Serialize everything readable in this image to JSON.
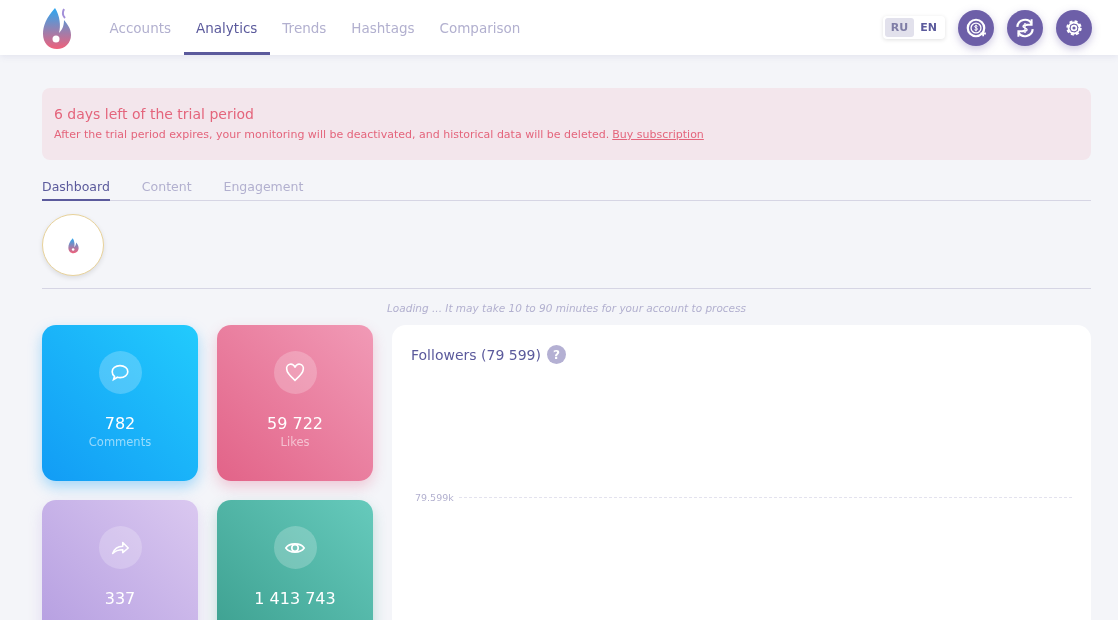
{
  "nav": {
    "items": [
      {
        "label": "Accounts",
        "selected": false
      },
      {
        "label": "Analytics",
        "selected": true
      },
      {
        "label": "Trends",
        "selected": false
      },
      {
        "label": "Hashtags",
        "selected": false
      },
      {
        "label": "Comparison",
        "selected": false
      }
    ]
  },
  "languages": [
    {
      "label": "RU",
      "selected": false
    },
    {
      "label": "EN",
      "selected": true
    }
  ],
  "header_buttons": [
    {
      "kind": "coin"
    },
    {
      "kind": "exchange"
    },
    {
      "kind": "settings"
    }
  ],
  "trial_banner": {
    "title": "6 days left of the trial period",
    "message": "After the trial period expires, your monitoring will be deactivated, and historical data will be deleted.",
    "link": "Buy subscription"
  },
  "tabs": [
    {
      "label": "Dashboard",
      "selected": true
    },
    {
      "label": "Content",
      "selected": false
    },
    {
      "label": "Engagement",
      "selected": false
    }
  ],
  "loading_note": "Loading ... It may take 10 to 90 minutes for your account to process",
  "stats": [
    {
      "kind": "comments",
      "value": "782",
      "label": "Comments"
    },
    {
      "kind": "likes",
      "value": "59 722",
      "label": "Likes"
    },
    {
      "kind": "shares",
      "value": "337"
    },
    {
      "kind": "views",
      "value": "1 413 743"
    }
  ],
  "followers_chart": {
    "title": "Followers (79 599)",
    "help": "?",
    "y_tick_label": "79.599k"
  }
}
